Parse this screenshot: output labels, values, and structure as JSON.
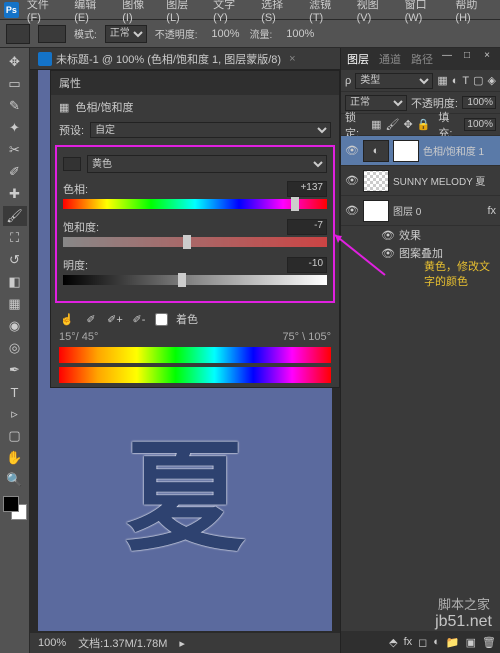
{
  "menu": {
    "file": "文件(F)",
    "edit": "编辑(E)",
    "image": "图像(I)",
    "layer": "图层(L)",
    "type": "文字(Y)",
    "select": "选择(S)",
    "filter": "滤镜(T)",
    "view": "视图(V)",
    "window": "窗口(W)",
    "help": "帮助(H)"
  },
  "optbar": {
    "mode_lbl": "模式:",
    "mode_val": "正常",
    "opacity_lbl": "不透明度:",
    "opacity_val": "100%",
    "flow_lbl": "流量:",
    "flow_val": "100%"
  },
  "doc": {
    "title": "未标题-1 @ 100% (色相/饱和度 1, 图层蒙版/8)"
  },
  "status": {
    "zoom": "100%",
    "docsize": "文档:1.37M/1.78M"
  },
  "panels": {
    "layers_tab": "图层",
    "channels_tab": "通道",
    "paths_tab": "路径",
    "kind_lbl": "类型",
    "blend_val": "正常",
    "opacity_lbl": "不透明度:",
    "opacity_val": "100%",
    "lock_lbl": "锁定:",
    "fill_lbl": "填充:",
    "fill_val": "100%"
  },
  "layers": [
    {
      "name": "色相/饱和度 1",
      "sel": true,
      "type": "adj"
    },
    {
      "name": "SUNNY MELODY 夏",
      "sel": false,
      "type": "text"
    },
    {
      "name": "图层 0",
      "sel": false,
      "type": "raster",
      "fx": true
    }
  ],
  "fx": {
    "effects": "效果",
    "overlay": "图案叠加"
  },
  "props": {
    "panel_title": "属性",
    "adj_title": "色相/饱和度",
    "preset_lbl": "预设:",
    "preset_val": "自定",
    "channel_val": "黄色",
    "hue_lbl": "色相:",
    "hue_val": "+137",
    "sat_lbl": "饱和度:",
    "sat_val": "-7",
    "light_lbl": "明度:",
    "light_val": "-10",
    "colorize_lbl": "着色",
    "deg_left": "15°/ 45°",
    "deg_right": "75° \\ 105°"
  },
  "annotation": {
    "line1": "黄色，修改文",
    "line2": "字的颜色"
  },
  "watermark": {
    "site": "jb51.net",
    "name": "脚本之家"
  },
  "canvas": {
    "bigchar": "夏"
  }
}
